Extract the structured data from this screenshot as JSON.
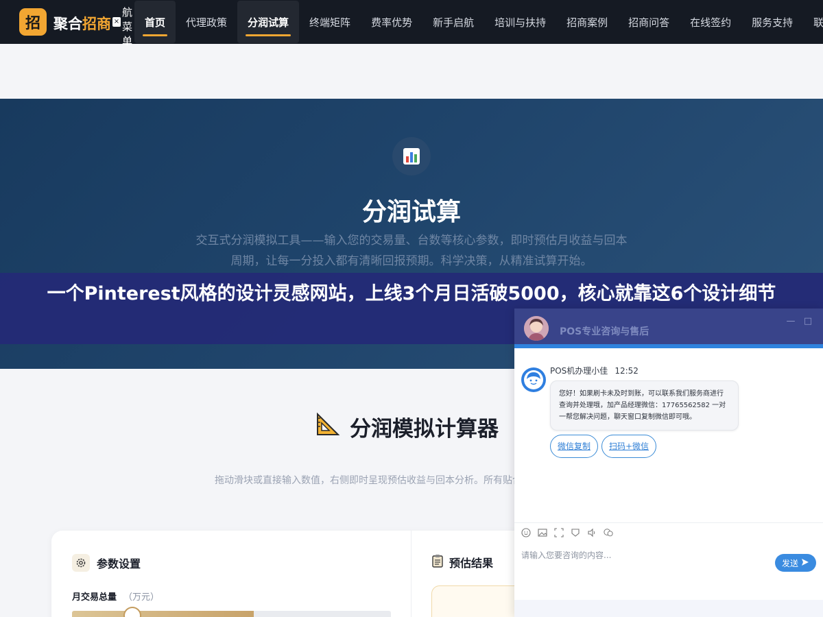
{
  "nav": {
    "logo_char": "招",
    "brand_main": "聚合",
    "brand_accent": "招商",
    "close_label": "×",
    "menu_label": "航菜单",
    "items": [
      {
        "label": "首页"
      },
      {
        "label": "代理政策"
      },
      {
        "label": "分润试算"
      },
      {
        "label": "终端矩阵"
      },
      {
        "label": "费率优势"
      },
      {
        "label": "新手启航"
      },
      {
        "label": "培训与扶持"
      },
      {
        "label": "招商案例"
      },
      {
        "label": "招商问答"
      },
      {
        "label": "在线签约"
      },
      {
        "label": "服务支持"
      },
      {
        "label": "联系"
      }
    ],
    "active_index": 2
  },
  "hero": {
    "icon": "chart-icon",
    "title": "分润试算",
    "description": "交互式分润模拟工具——输入您的交易量、台数等核心参数，即时预估月收益与回本周期，让每一分投入都有清晰回报预期。科学决策，从精准试算开始。"
  },
  "banner": {
    "text": "一个Pinterest风格的设计灵感网站，上线3个月日活破5000，核心就靠这6个设计细节"
  },
  "calculator": {
    "title_icon": "triangle-ruler-icon",
    "title": "分润模拟计算器",
    "description": "拖动滑块或直接输入数值，右侧即时呈现预估收益与回本分析。所有贴合您的实际业务场景。",
    "params": {
      "icon": "gear-icon",
      "title": "参数设置",
      "field_label": "月交易总量",
      "field_unit": "（万元）",
      "slider_fraction": 0.19
    },
    "results": {
      "icon": "clipboard-icon",
      "title": "预估结果"
    }
  },
  "chat": {
    "title": "POS专业咨询与售后",
    "minimize_label": "—",
    "maximize_label": "□",
    "agent_name": "POS机办理小佳",
    "time": "12:52",
    "message": "您好！如果刷卡未及时到账，可以联系我们服务商进行查询并处理哦，加产品经理微信：17765562582 一对一帮您解决问题，聊天窗口复制微信即可哦。",
    "buttons": [
      "微信复制",
      "扫码+微信"
    ],
    "input_placeholder": "请输入您要咨询的内容...",
    "send_label": "发送",
    "colors": {
      "accent": "#3a8be0",
      "header": "#283480"
    }
  },
  "colors": {
    "brand": "#f2a632",
    "nav_bg": "#151a23",
    "hero_bg": "#1f446b",
    "banner_bg": "#232a76"
  }
}
